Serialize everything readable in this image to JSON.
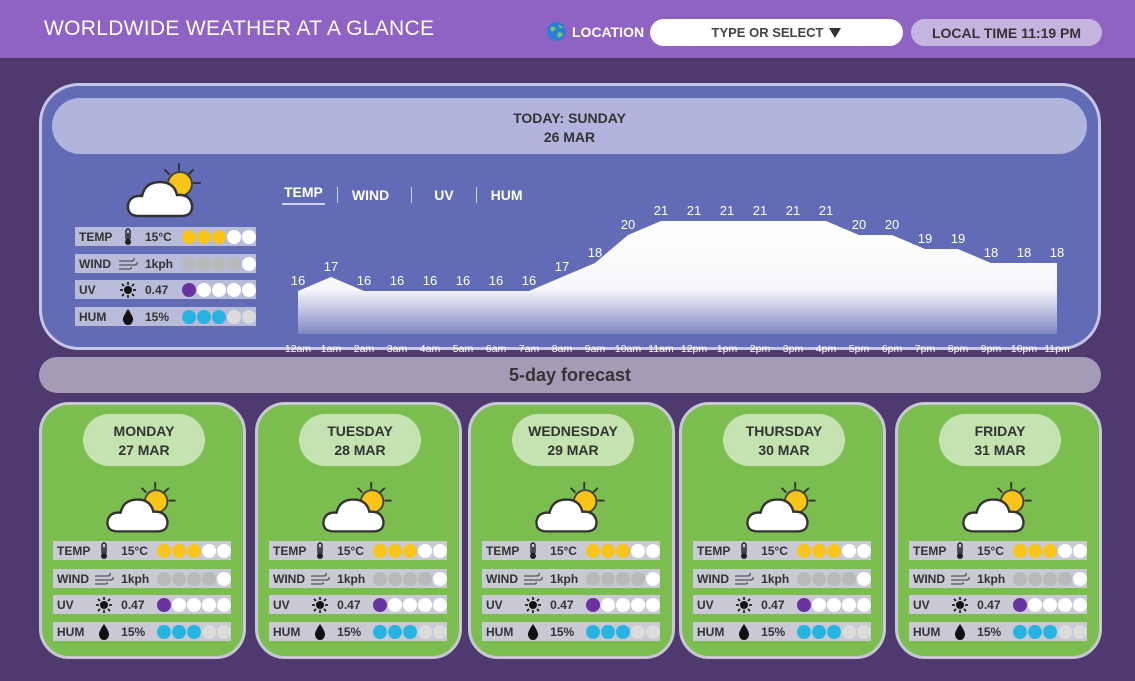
{
  "header": {
    "title": "WORLDWIDE WEATHER AT A GLANCE",
    "location_label": "LOCATION",
    "location_select": "TYPE OR SELECT",
    "local_time": "LOCAL TIME 11:19 PM"
  },
  "today": {
    "title": "TODAY: SUNDAY",
    "date": "26 MAR",
    "stats": [
      {
        "label": "TEMP",
        "icon": "thermometer-icon",
        "value": "15°C",
        "level": 3,
        "kind": "temp"
      },
      {
        "label": "WIND",
        "icon": "wind-icon",
        "value": "1kph",
        "level": 4,
        "kind": "wind"
      },
      {
        "label": "UV",
        "icon": "sun-icon",
        "value": "0.47",
        "level": 1,
        "kind": "uv"
      },
      {
        "label": "HUM",
        "icon": "droplet-icon",
        "value": "15%",
        "level": 3,
        "kind": "hum"
      }
    ],
    "tabs": [
      "TEMP",
      "WIND",
      "UV",
      "HUM"
    ],
    "active_tab": "TEMP"
  },
  "chart_data": {
    "type": "area",
    "categories": [
      "12am",
      "1am",
      "2am",
      "3am",
      "4am",
      "5am",
      "6am",
      "7am",
      "8am",
      "9am",
      "10am",
      "11am",
      "12pm",
      "1pm",
      "2pm",
      "3pm",
      "4pm",
      "5pm",
      "6pm",
      "7pm",
      "8pm",
      "9pm",
      "10pm",
      "11pm"
    ],
    "values": [
      16,
      17,
      16,
      16,
      16,
      16,
      16,
      16,
      17,
      18,
      20,
      21,
      21,
      21,
      21,
      21,
      21,
      20,
      20,
      19,
      19,
      18,
      18,
      18
    ],
    "ylim": [
      14,
      22
    ]
  },
  "forecast": {
    "banner": "5-day forecast",
    "days": [
      {
        "day": "MONDAY",
        "date": "27 MAR"
      },
      {
        "day": "TUESDAY",
        "date": "28 MAR"
      },
      {
        "day": "WEDNESDAY",
        "date": "29 MAR"
      },
      {
        "day": "THURSDAY",
        "date": "30 MAR"
      },
      {
        "day": "FRIDAY",
        "date": "31 MAR"
      }
    ],
    "stats": [
      {
        "label": "TEMP",
        "icon": "thermometer-icon",
        "value": "15°C",
        "level": 3,
        "kind": "temp"
      },
      {
        "label": "WIND",
        "icon": "wind-icon",
        "value": "1kph",
        "level": 4,
        "kind": "wind"
      },
      {
        "label": "UV",
        "icon": "sun-icon",
        "value": "0.47",
        "level": 1,
        "kind": "uv"
      },
      {
        "label": "HUM",
        "icon": "droplet-icon",
        "value": "15%",
        "level": 3,
        "kind": "hum"
      }
    ]
  },
  "colors": {
    "header": "#8f63c4",
    "background": "#4e3a6f",
    "today_panel": "#626bb5",
    "forecast_card": "#7bbd4e",
    "temp_dot": "#f7c417",
    "wind_dot": "#b9b9b9",
    "uv_dot": "#6a32a0",
    "hum_dot": "#27b4e3"
  }
}
